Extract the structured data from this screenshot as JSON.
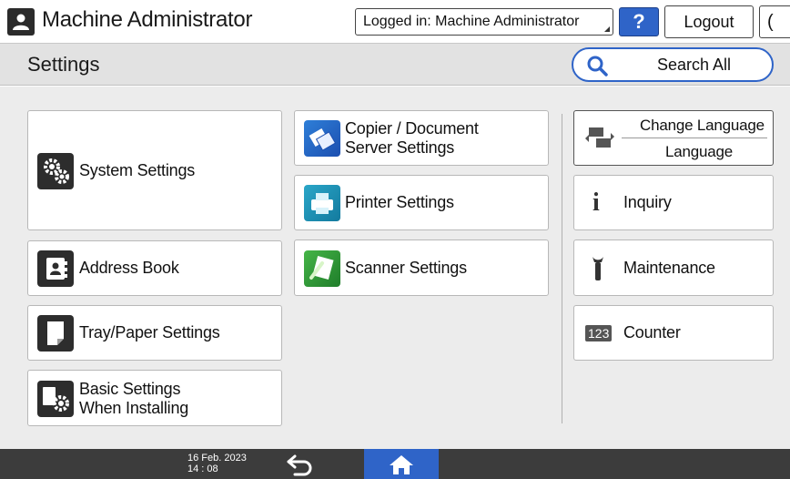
{
  "topbar": {
    "user_name": "Machine Administrator",
    "logged_in": "Logged in: Machine Administrator",
    "help_label": "?",
    "logout_label": "Logout",
    "moon_symbol": "(",
    "icons": {
      "user": "user-icon",
      "moon": "moon-icon"
    }
  },
  "header": {
    "title": "Settings",
    "search_label": "Search All",
    "search_icon": "search-icon"
  },
  "tiles": {
    "system_settings": "System Settings",
    "address_book": "Address Book",
    "tray_paper": "Tray/Paper Settings",
    "basic_line1": "Basic Settings",
    "basic_line2": "When Installing",
    "copier_line1": "Copier / Document",
    "copier_line2": "Server Settings",
    "printer": "Printer Settings",
    "scanner": "Scanner Settings",
    "change_language": "Change Language",
    "language": "Language",
    "inquiry": "Inquiry",
    "maintenance": "Maintenance",
    "counter": "Counter",
    "counter_badge": "123"
  },
  "footer": {
    "date": "16 Feb. 2023",
    "time": "14 : 08",
    "icons": {
      "back": "back-arrow-icon",
      "home": "home-icon"
    }
  },
  "colors": {
    "accent": "#2f64c8",
    "header_bg": "#e2e2e2",
    "main_bg": "#ececec",
    "footer_bg": "#3c3c3c"
  }
}
